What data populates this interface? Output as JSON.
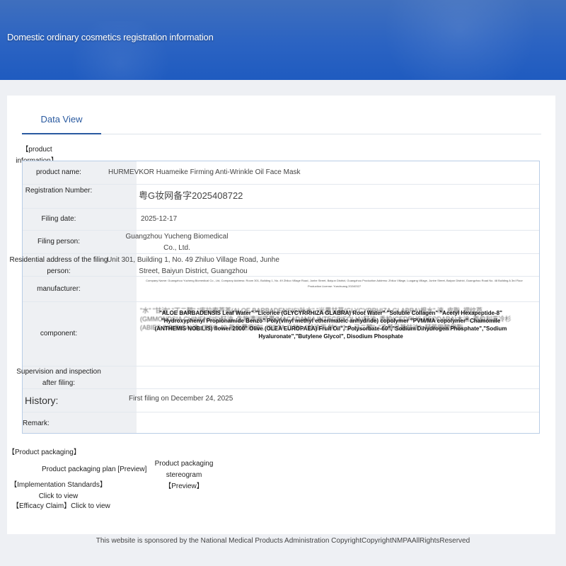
{
  "header": {
    "title": "Domestic ordinary cosmetics registration information"
  },
  "tabs": [
    {
      "label": "Data View"
    }
  ],
  "product_info": {
    "section_title": "【product information】",
    "fields": {
      "product_name": {
        "label": "product name:",
        "value": "HURMEVKOR Huameike Firming Anti-Wrinkle Oil Face Mask"
      },
      "registration_number": {
        "label": "Registration Number:",
        "value": "粤G妆网备字2025408722"
      },
      "filing_date": {
        "label": "Filing date:",
        "value": "2025-12-17"
      },
      "filing_person": {
        "label": "Filing person:",
        "value": "Guangzhou Yucheng Biomedical Co., Ltd."
      },
      "residential_address": {
        "label": "Residential address of the filing person:",
        "value": "Unit 301, Building 1, No. 49 Zhiluo Village Road, Junhe Street, Baiyun District, Guangzhou"
      },
      "manufacturer": {
        "label": "manufacturer:",
        "value": "Company Name: Guangzhou Yucheng Biomedical Co., Ltd, Company Address: Room 301, Building 1, No. 49 Zhiluo Village Road, Junhe Street, Baiyun District, Guangzhou Production Address: Zhiluo Village, Luogang Village, Junhe Street, Baiyun District, Guangzhou Road No. 48 Building A 3rd Floor Production License: Yuechuang 20240327"
      },
      "component": {
        "label": "component:",
        "value": "\"ALOE BARBADENSIS Leaf Water\" \"Licorice (GLYCYRRHIZA GLABRA) Root Water\" \"Soluble Collagen\" \"Acetyl Hexapeptide-8\" \"Hydroxyphenyl Propionamide Benzo\" Poly(vinyl methyl ether/maleic anhydride) copolymer \"PVM/MA copolymer\" Chamomile (ANTHEMIS NOBILIS) flower 2000\" Olive (OLEA EUROPAEA) Fruit Oil\",\"Polysorbate-60\",\"Sodium Dihydrogen Phosphate\",\"Sodium Hyaluronate\",\"Butylene Glycol\", Disodium Phosphate",
        "background_text": "\"水\" \"甘油\" \"丁二醇\" \"库拉索芦荟(ALOE BARBADENSIS)叶水\" \"光果甘草(GLYCYRRHIZA GLABRA)根水\" 液, 皮脂, 褶纹芦 (GMMONDSIA CHINENSIS)籽油, 生物澳洲坚果(MACADAMIA INTEGRIFOLIA)籽油, 香柏(CEDRUS DEODARA)木油, 西伯利亚冷杉(ABIES SIBIRICA)油, \"PEG-40 氢化蓖麻油\", \"EDTA 二钠\", \"甘油丙 钠\", \"1,2-己二醇\", \"乙基己基甘油\", 羟苯甲酸甲酯"
      },
      "supervision": {
        "label": "Supervision and inspection after filing:",
        "value": ""
      },
      "history": {
        "label": "History:",
        "value": "First filing on December 24, 2025"
      },
      "remark": {
        "label": "Remark:",
        "value": ""
      }
    }
  },
  "packaging": {
    "section_title": "【Product packaging】",
    "plan_label": "Product packaging plan [Preview]",
    "stereogram_label": "Product packaging stereogram【Preview】",
    "standards_label": "【Implementation Standards】Click to view",
    "efficacy_label": "【Efficacy Claim】Click to view"
  },
  "footer": {
    "text": "This website is sponsored by the National Medical Products Administration CopyrightCopyrightNMPAAllRightsReserved"
  },
  "colors": {
    "banner": "#2b63c2",
    "accent": "#2a5aa0",
    "table_border": "#b9cde6",
    "label_bg": "#eef0f3"
  }
}
